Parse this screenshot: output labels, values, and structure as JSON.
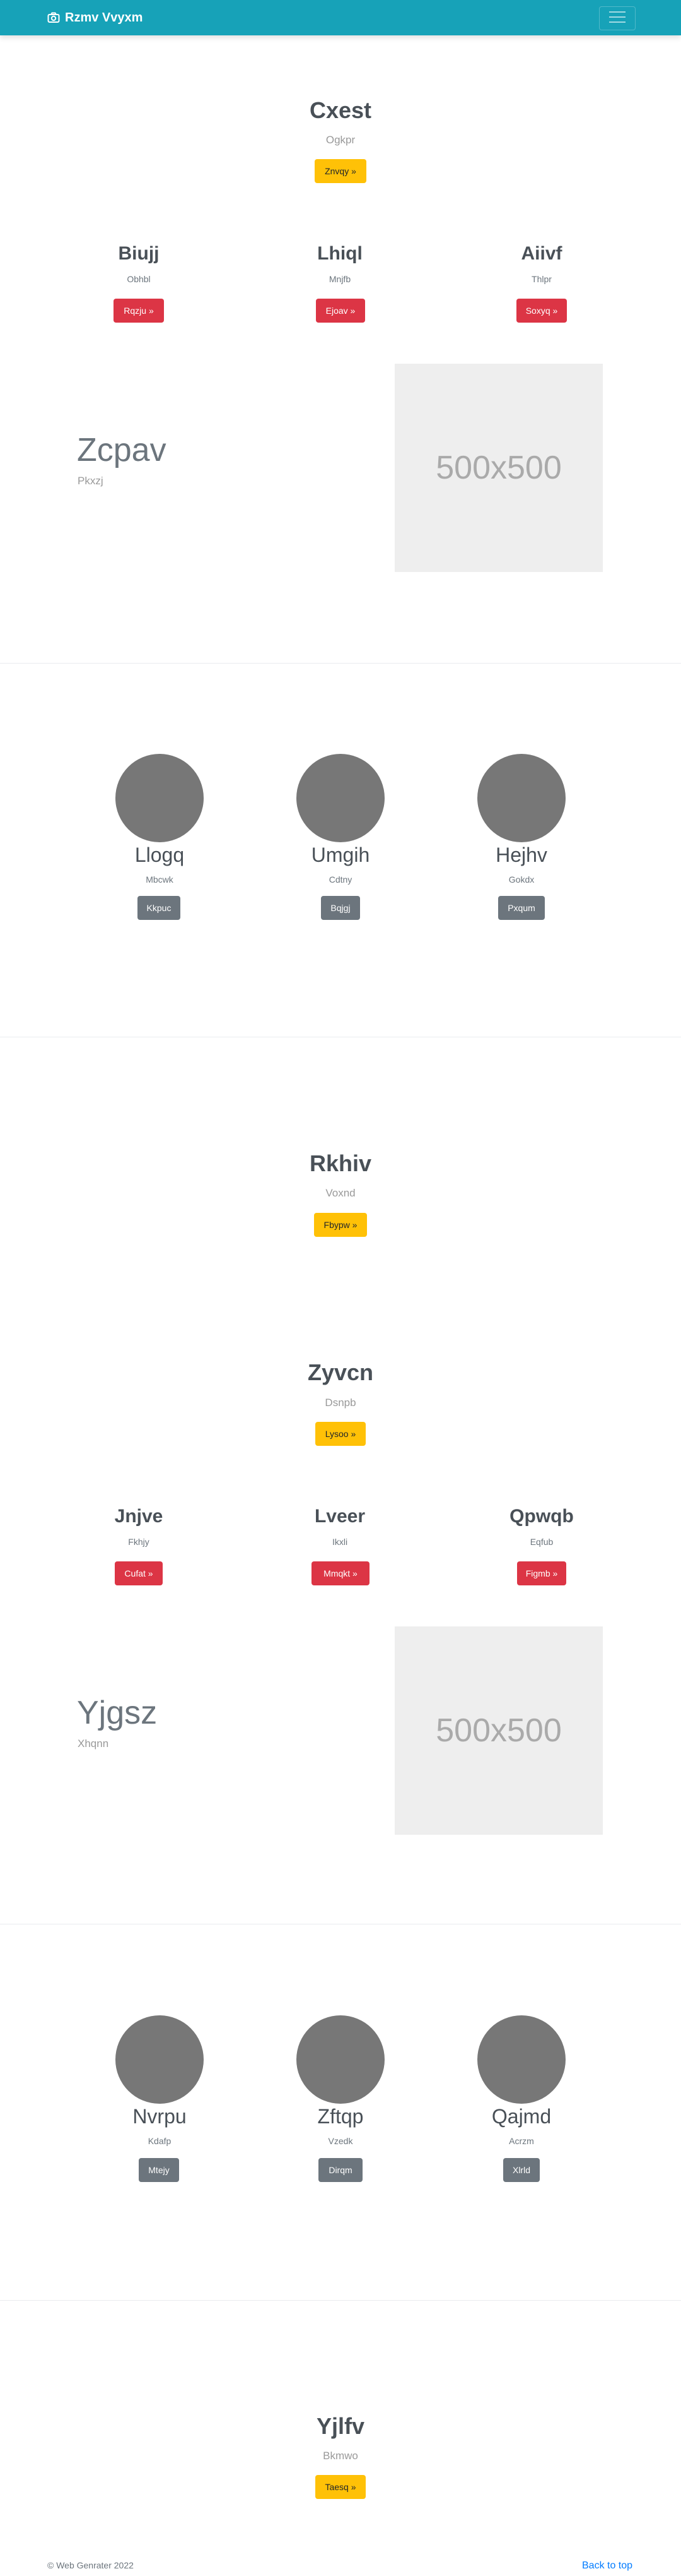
{
  "navbar": {
    "brand": "Rzmv Vvyxm",
    "icons": {
      "brand": "camera-icon",
      "toggler": "menu-icon"
    }
  },
  "hero1": {
    "title": "Cxest",
    "subtitle": "Ogkpr",
    "button": "Znvqy »"
  },
  "cols1": [
    {
      "title": "Biujj",
      "sub": "Obhbl",
      "button": "Rqzju »"
    },
    {
      "title": "Lhiql",
      "sub": "Mnjfb",
      "button": "Ejoav »"
    },
    {
      "title": "Aiivf",
      "sub": "Thlpr",
      "button": "Soxyq »"
    }
  ],
  "feature1": {
    "title": "Zcpav",
    "subtitle": "Pkxzj",
    "placeholder": "500x500"
  },
  "team1": [
    {
      "name": "Llogq",
      "sub": "Mbcwk",
      "button": "Kkpuc"
    },
    {
      "name": "Umgih",
      "sub": "Cdtny",
      "button": "Bqjgj"
    },
    {
      "name": "Hejhv",
      "sub": "Gokdx",
      "button": "Pxqum"
    }
  ],
  "hero2": {
    "title": "Rkhiv",
    "subtitle": "Voxnd",
    "button": "Fbypw »"
  },
  "hero3": {
    "title": "Zyvcn",
    "subtitle": "Dsnpb",
    "button": "Lysoo »"
  },
  "cols2": [
    {
      "title": "Jnjve",
      "sub": "Fkhjy",
      "button": "Cufat »"
    },
    {
      "title": "Lveer",
      "sub": "Ikxli",
      "button": "Mmqkt »"
    },
    {
      "title": "Qpwqb",
      "sub": "Eqfub",
      "button": "Figmb »"
    }
  ],
  "feature2": {
    "title": "Yjgsz",
    "subtitle": "Xhqnn",
    "placeholder": "500x500"
  },
  "team2": [
    {
      "name": "Nvrpu",
      "sub": "Kdafp",
      "button": "Mtejy"
    },
    {
      "name": "Zftqp",
      "sub": "Vzedk",
      "button": "Dirqm"
    },
    {
      "name": "Qajmd",
      "sub": "Acrzm",
      "button": "Xlrld"
    }
  ],
  "hero4": {
    "title": "Yjlfv",
    "subtitle": "Bkmwo",
    "button": "Taesq »"
  },
  "footer": {
    "copyright": "© Web Genrater 2022",
    "back_to_top": "Back to top"
  },
  "colors": {
    "navbar": "#17a2b8",
    "warning": "#ffc107",
    "danger": "#dc3545",
    "secondary": "#6c757d",
    "link": "#007bff"
  }
}
